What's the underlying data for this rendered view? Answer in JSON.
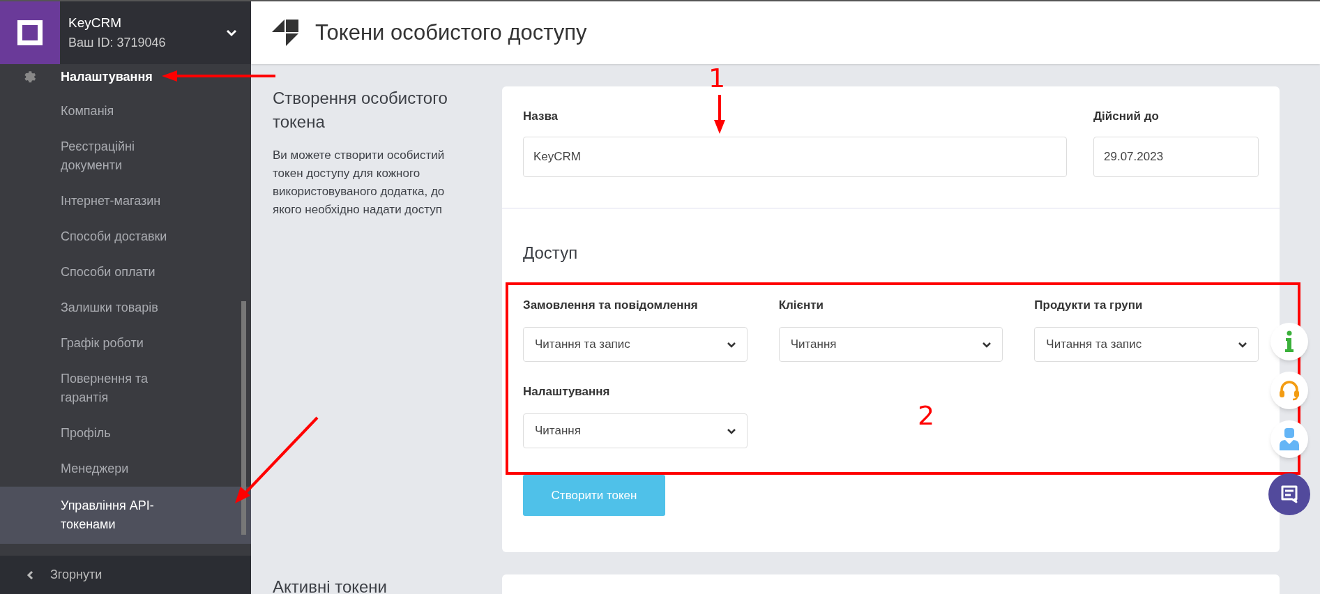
{
  "account": {
    "name": "KeyCRM",
    "id": "Ваш ID: 3719046"
  },
  "sidebar": {
    "section": "Налаштування",
    "items": [
      {
        "label": "Компанія",
        "selected": false
      },
      {
        "label": "Реєстраційні документи",
        "selected": false
      },
      {
        "label": "Інтернет-магазин",
        "selected": false
      },
      {
        "label": "Способи доставки",
        "selected": false
      },
      {
        "label": "Способи оплати",
        "selected": false
      },
      {
        "label": "Залишки товарів",
        "selected": false
      },
      {
        "label": "Графік роботи",
        "selected": false
      },
      {
        "label": "Повернення та гарантія",
        "selected": false
      },
      {
        "label": "Профіль",
        "selected": false
      },
      {
        "label": "Менеджери",
        "selected": false
      },
      {
        "label": "Управління API-токенами",
        "selected": true
      }
    ],
    "collapse": "Згорнути"
  },
  "page_title": "Токени особистого доступу",
  "intro": {
    "title": "Створення особистого токена",
    "text": "Ви можете створити особистий токен доступу для кожного використовуваного додатка, до якого необхідно надати доступ"
  },
  "form": {
    "name_label": "Назва",
    "name_value": "KeyCRM",
    "date_label": "Дійсний до",
    "date_value": "29.07.2023",
    "access_title": "Доступ",
    "permissions": [
      {
        "label": "Замовлення та повідомлення",
        "value": "Читання та запис"
      },
      {
        "label": "Клієнти",
        "value": "Читання"
      },
      {
        "label": "Продукти та групи",
        "value": "Читання та запис"
      },
      {
        "label": "Налаштування",
        "value": "Читання"
      }
    ],
    "submit": "Створити токен"
  },
  "active_title": "Активні токени",
  "annotations": [
    "1",
    "2"
  ]
}
